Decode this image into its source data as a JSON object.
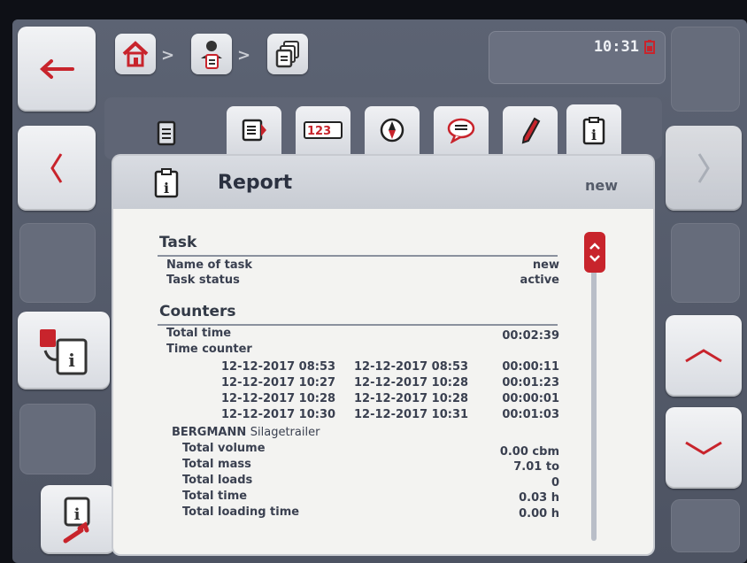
{
  "clock": {
    "time": "10:31"
  },
  "header": {
    "title": "Report",
    "task_name_right": "new"
  },
  "tabs": [
    {
      "name": "tab-task",
      "icon": "clipboard-icon"
    },
    {
      "name": "tab-list",
      "icon": "document-arrow-icon"
    },
    {
      "name": "tab-counters",
      "icon": "counter-123-icon"
    },
    {
      "name": "tab-navigation",
      "icon": "compass-icon"
    },
    {
      "name": "tab-comments",
      "icon": "speech-bubble-icon"
    },
    {
      "name": "tab-edit",
      "icon": "pencil-icon"
    },
    {
      "name": "tab-report",
      "icon": "info-clipboard-icon",
      "active": true
    }
  ],
  "report": {
    "task_section": "Task",
    "name_of_task_label": "Name of task",
    "name_of_task_value": "new",
    "task_status_label": "Task status",
    "task_status_value": "active",
    "counters_section": "Counters",
    "total_time_label": "Total time",
    "total_time_value": "00:02:39",
    "time_counter_label": "Time counter",
    "time_rows": [
      {
        "start": "12-12-2017 08:53",
        "end": "12-12-2017 08:53",
        "duration": "00:00:11"
      },
      {
        "start": "12-12-2017 10:27",
        "end": "12-12-2017 10:28",
        "duration": "00:01:23"
      },
      {
        "start": "12-12-2017 10:28",
        "end": "12-12-2017 10:28",
        "duration": "00:00:01"
      },
      {
        "start": "12-12-2017 10:30",
        "end": "12-12-2017 10:31",
        "duration": "00:01:03"
      }
    ],
    "machine_brand_bold": "BERGMANN",
    "machine_name": "Silagetrailer",
    "machine_rows": [
      {
        "label": "Total volume",
        "value": "0.00 cbm"
      },
      {
        "label": "Total mass",
        "value": "7.01 to"
      },
      {
        "label": "Total loads",
        "value": "0"
      },
      {
        "label": "Total time",
        "value": "0.03 h"
      },
      {
        "label": "Total loading time",
        "value": "0.00 h"
      }
    ]
  },
  "colors": {
    "accent_red": "#c8242c",
    "panel_bg": "#f3f3f1",
    "frame_bg": "#5c6373"
  }
}
